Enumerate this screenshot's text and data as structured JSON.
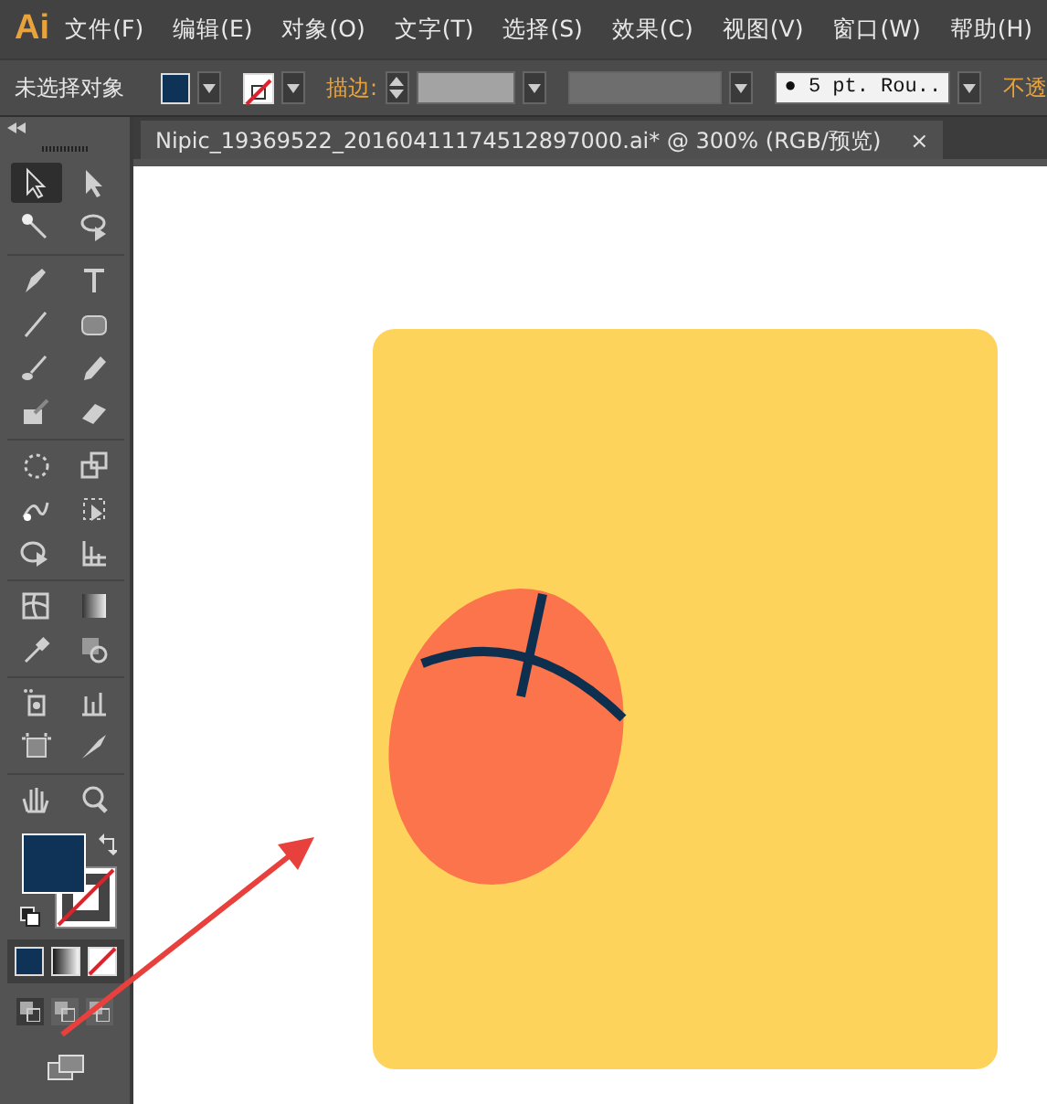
{
  "app": {
    "logo": "Ai"
  },
  "menu": [
    {
      "label": "文件(F)"
    },
    {
      "label": "编辑(E)"
    },
    {
      "label": "对象(O)"
    },
    {
      "label": "文字(T)"
    },
    {
      "label": "选择(S)"
    },
    {
      "label": "效果(C)"
    },
    {
      "label": "视图(V)"
    },
    {
      "label": "窗口(W)"
    },
    {
      "label": "帮助(H)"
    }
  ],
  "control_bar": {
    "selection_label": "未选择对象",
    "stroke_label": "描边:",
    "brush": "● 5 pt. Rou..",
    "opacity_label": "不透"
  },
  "document_tab": {
    "title": "Nipic_19369522_20160411174512897000.ai*  @  300%  (RGB/预览)",
    "close": "×",
    "selected": true
  },
  "tools": [
    {
      "kind": "selection",
      "selected": true
    },
    {
      "kind": "direct-selection",
      "selected": false
    },
    {
      "kind": "magic-wand",
      "selected": false
    },
    {
      "kind": "lasso",
      "selected": false
    },
    {
      "kind": "pen",
      "selected": false
    },
    {
      "kind": "type",
      "selected": false
    },
    {
      "kind": "line",
      "selected": false
    },
    {
      "kind": "rectangle",
      "selected": false
    },
    {
      "kind": "paintbrush",
      "selected": false
    },
    {
      "kind": "pencil",
      "selected": false
    },
    {
      "kind": "blob-brush",
      "selected": false
    },
    {
      "kind": "eraser",
      "selected": false
    },
    {
      "kind": "rotate",
      "selected": false
    },
    {
      "kind": "scale",
      "selected": false
    },
    {
      "kind": "warp",
      "selected": false
    },
    {
      "kind": "free-transform",
      "selected": false
    },
    {
      "kind": "shape-builder",
      "selected": false
    },
    {
      "kind": "perspective-grid",
      "selected": false
    },
    {
      "kind": "mesh",
      "selected": false
    },
    {
      "kind": "gradient",
      "selected": false
    },
    {
      "kind": "eyedropper",
      "selected": false
    },
    {
      "kind": "blend",
      "selected": false
    },
    {
      "kind": "symbol-sprayer",
      "selected": false
    },
    {
      "kind": "column-graph",
      "selected": false
    },
    {
      "kind": "artboard",
      "selected": false
    },
    {
      "kind": "slice",
      "selected": false
    },
    {
      "kind": "hand",
      "selected": false
    },
    {
      "kind": "zoom",
      "selected": false
    }
  ],
  "draw_modes": [
    {
      "selected": true
    },
    {
      "selected": false
    },
    {
      "selected": false
    }
  ]
}
